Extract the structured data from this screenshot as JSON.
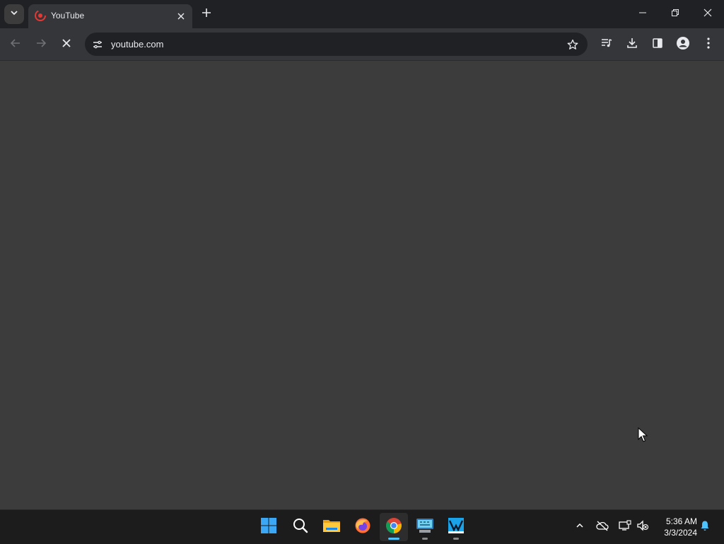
{
  "browser": {
    "tab": {
      "title": "YouTube",
      "favicon": "youtube-favicon"
    },
    "address_bar": {
      "url": "youtube.com"
    },
    "window_controls": [
      "minimize",
      "restore",
      "close"
    ]
  },
  "taskbar": {
    "apps": [
      {
        "name": "start",
        "icon": "windows-start-icon"
      },
      {
        "name": "search",
        "icon": "search-icon"
      },
      {
        "name": "file-explorer",
        "icon": "folder-icon"
      },
      {
        "name": "firefox",
        "icon": "firefox-icon"
      },
      {
        "name": "chrome",
        "icon": "chrome-icon",
        "active": true
      },
      {
        "name": "terminal",
        "icon": "keyboard-monitor-icon"
      },
      {
        "name": "visual-studio",
        "icon": "visual-studio-icon"
      }
    ],
    "clock": {
      "time": "5:36 AM",
      "date": "3/3/2024"
    }
  },
  "colors": {
    "titlebar": "#202124",
    "toolbar": "#35363a",
    "content": "#3c3c3c",
    "taskbar": "#1c1c1c",
    "accent": "#4cc2ff",
    "notification": "#4cc2ff"
  }
}
